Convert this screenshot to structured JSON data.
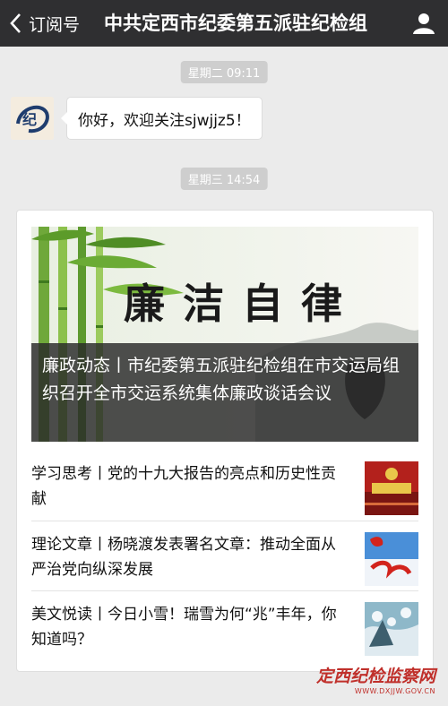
{
  "header": {
    "back_label": "订阅号",
    "title": "中共定西市纪委第五派驻纪检组",
    "icons": {
      "back": "chevron-left-icon",
      "profile": "person-icon"
    }
  },
  "messages": {
    "ts1": "星期二 09:11",
    "greeting": "你好，欢迎关注sjwjjz5！",
    "avatar_char": "纪",
    "ts2": "星期三 14:54"
  },
  "card": {
    "hero_art_text": "廉洁自律",
    "hero_caption": "廉政动态丨市纪委第五派驻纪检组在市交运局组织召开全市交运系统集体廉政谈话会议",
    "items": [
      {
        "text": "学习思考丨党的十九大报告的亮点和历史性贡献"
      },
      {
        "text": "理论文章丨杨晓渡发表署名文章：推动全面从严治党向纵深发展"
      },
      {
        "text": "美文悦读丨今日小雪！瑞雪为何“兆”丰年，你知道吗？"
      }
    ]
  },
  "watermark": {
    "main": "定西纪检监察网",
    "sub": "WWW.DXJJW.GOV.CN"
  },
  "colors": {
    "header_bg": "#2f2f31",
    "page_bg": "#ebebeb",
    "watermark": "#c0302b"
  }
}
